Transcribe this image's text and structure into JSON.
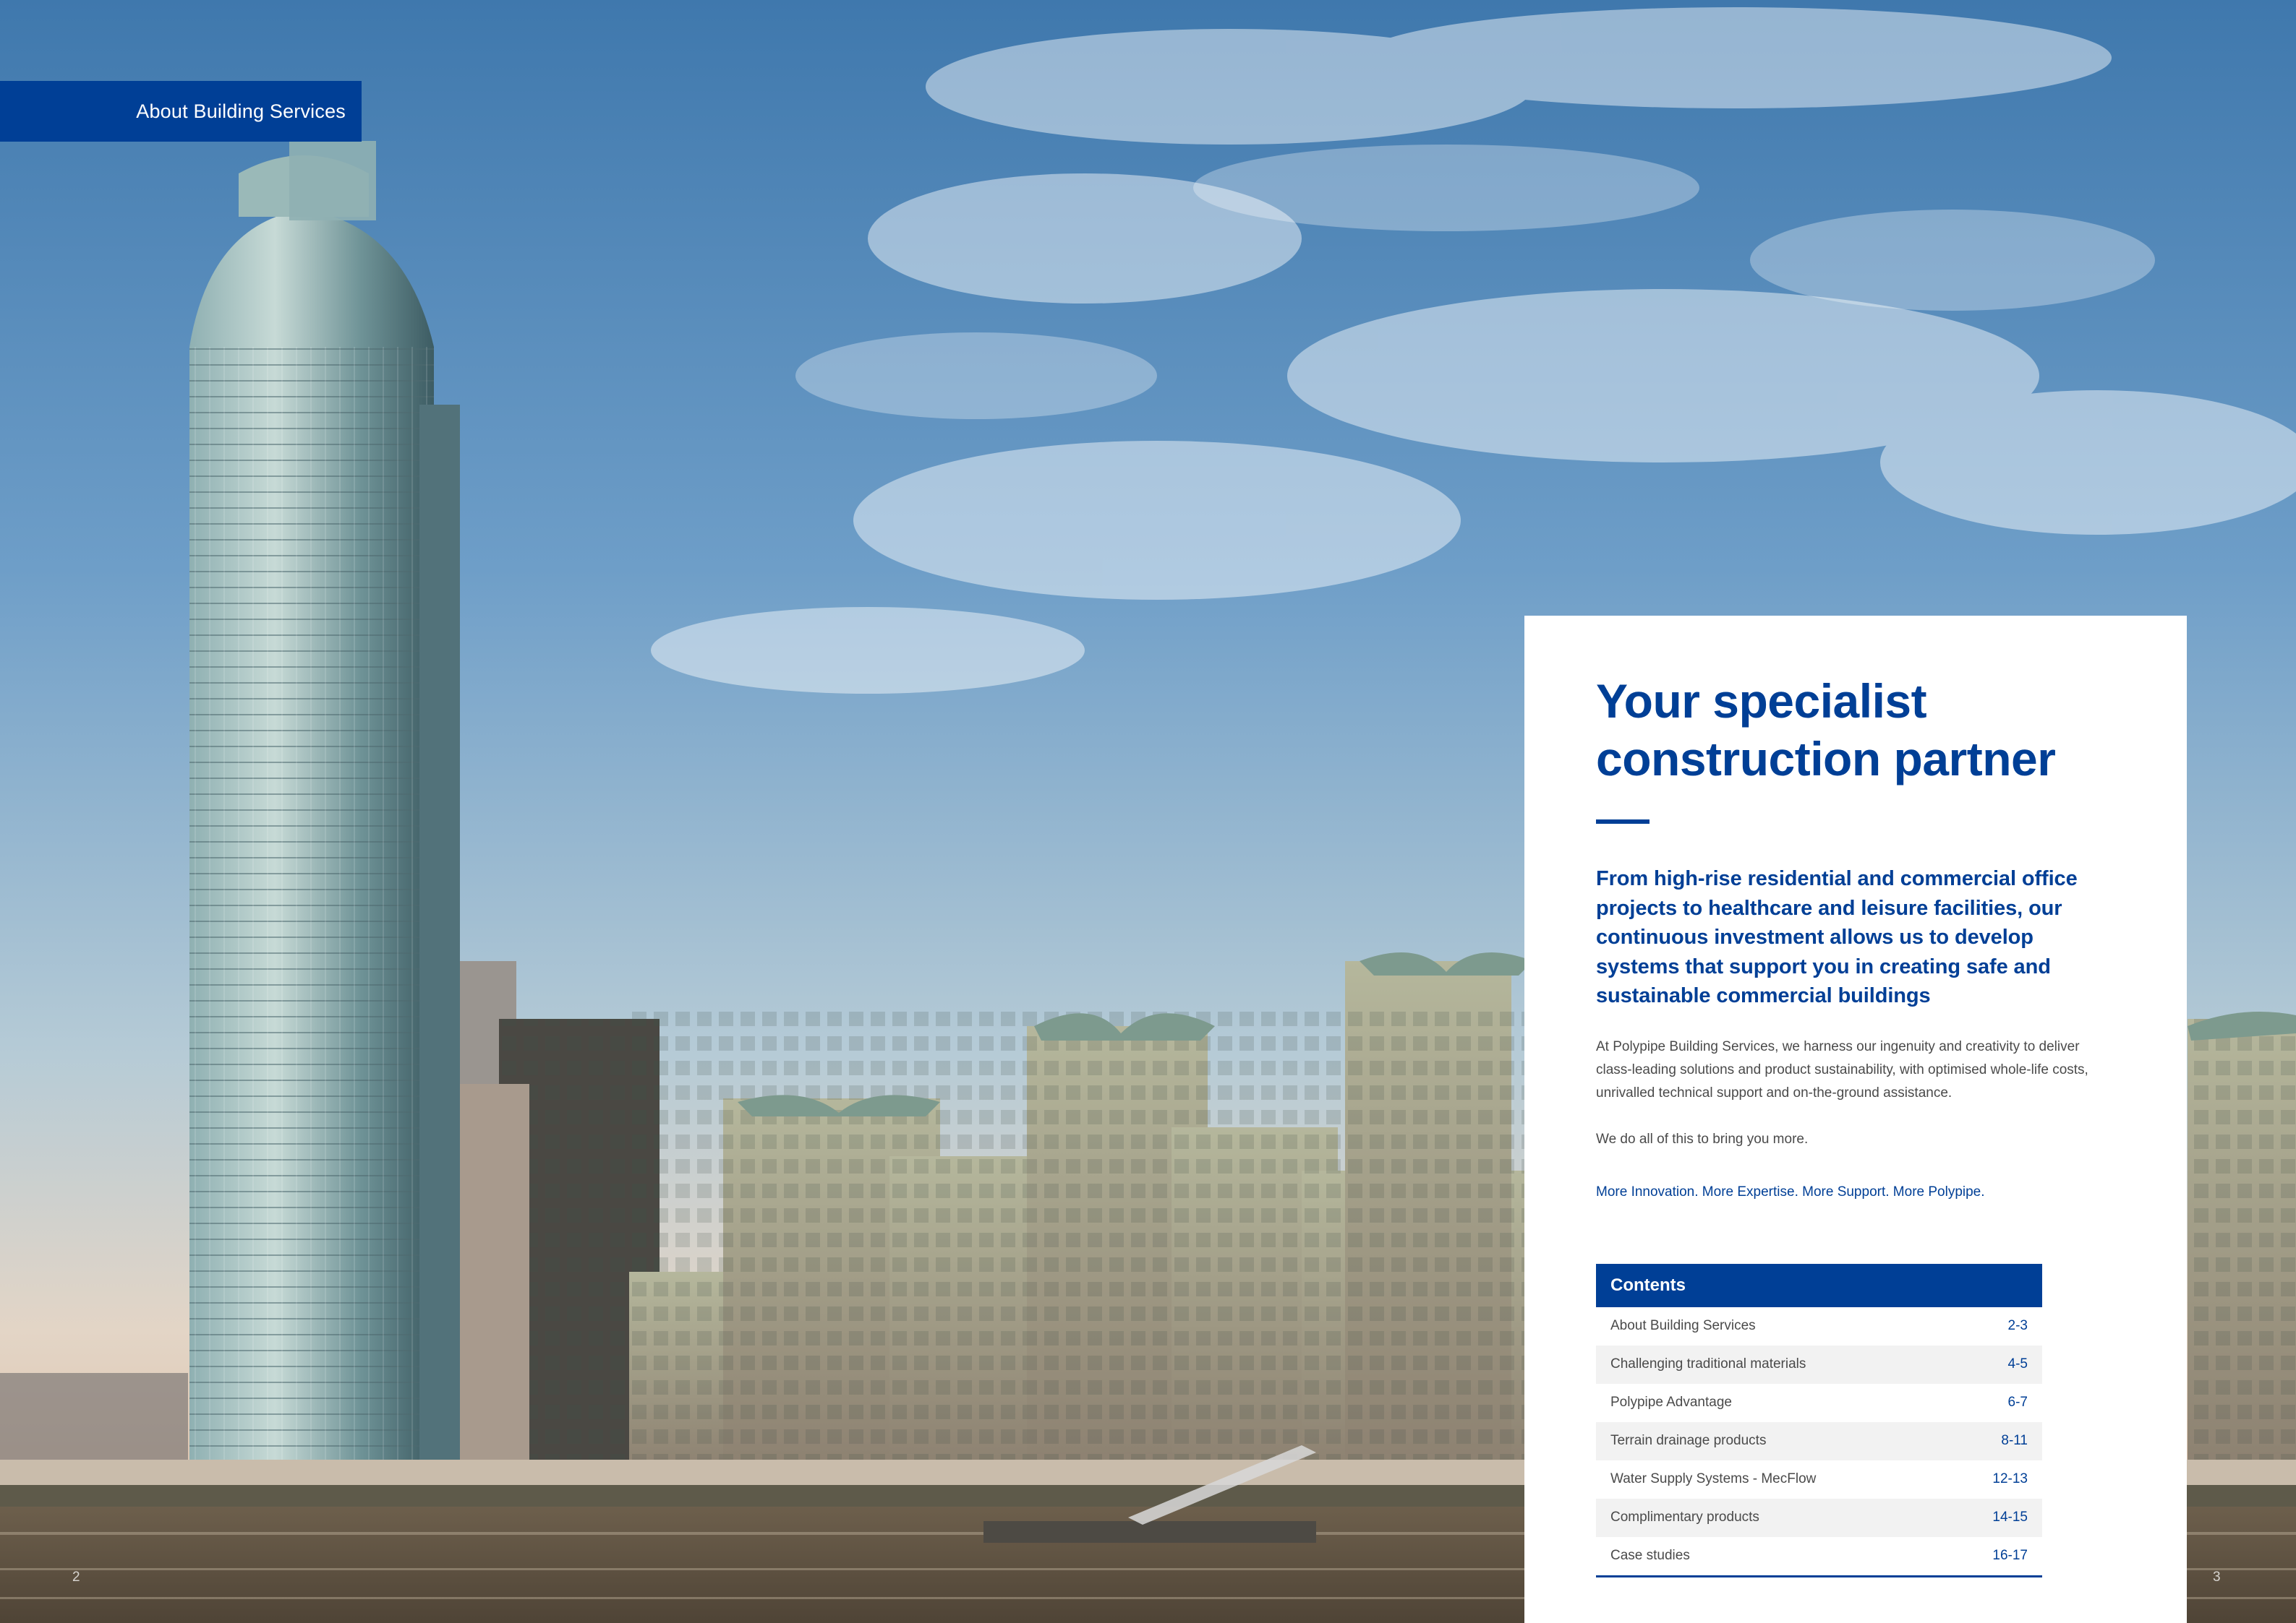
{
  "section_tab": "About Building Services",
  "page_numbers": {
    "left": "2",
    "right": "3"
  },
  "panel": {
    "headline_line1": "Your specialist",
    "headline_line2": "construction partner",
    "lead": "From high-rise residential and commercial office projects to healthcare and leisure facilities, our continuous investment allows us to develop systems that support you in creating safe and sustainable commercial buildings",
    "body_1": "At Polypipe Building Services, we harness our ingenuity and creativity to deliver class-leading  solutions and product sustainability, with optimised whole-life costs, unrivalled technical support and on-the-ground assistance.",
    "body_2": "We do all of this to bring you more.",
    "tagline": "More Innovation. More Expertise. More Support. More Polypipe."
  },
  "contents": {
    "title": "Contents",
    "items": [
      {
        "label": "About Building Services",
        "pages": "2-3"
      },
      {
        "label": "Challenging traditional materials",
        "pages": "4-5"
      },
      {
        "label": "Polypipe Advantage",
        "pages": "6-7"
      },
      {
        "label": "Terrain drainage products",
        "pages": "8-11"
      },
      {
        "label": "Water Supply Systems - MecFlow",
        "pages": "12-13"
      },
      {
        "label": "Complimentary products",
        "pages": "14-15"
      },
      {
        "label": "Case studies",
        "pages": "16-17"
      }
    ]
  },
  "colors": {
    "brand_blue": "#003f96",
    "row_alt": "#f2f2f2",
    "body_grey": "#4a4a4a"
  }
}
